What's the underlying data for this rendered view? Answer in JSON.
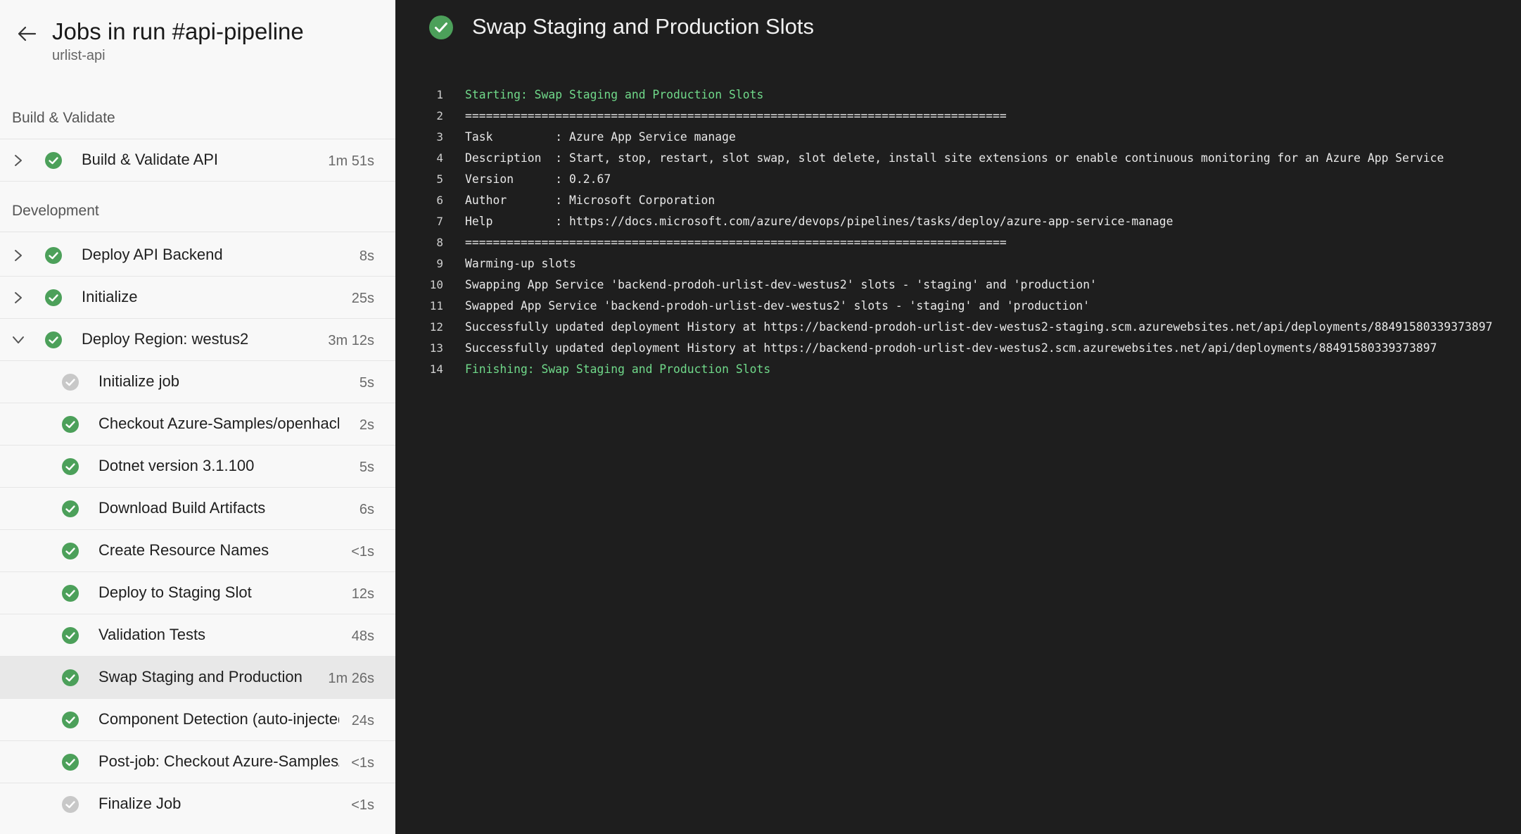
{
  "left_panel": {
    "title": "Jobs in run #api-pipeline",
    "subtitle": "urlist-api",
    "sections": [
      {
        "label": "Build & Validate"
      },
      {
        "label": "Development"
      }
    ],
    "jobs": [
      {
        "label": "Build & Validate API",
        "duration": "1m 51s",
        "expanded": false,
        "status": "succeeded"
      },
      {
        "label": "Deploy API Backend",
        "duration": "8s",
        "expanded": false,
        "status": "succeeded"
      },
      {
        "label": "Initialize",
        "duration": "25s",
        "expanded": false,
        "status": "succeeded"
      },
      {
        "label": "Deploy Region: westus2",
        "duration": "3m 12s",
        "expanded": true,
        "status": "succeeded"
      }
    ],
    "steps": [
      {
        "label": "Initialize job",
        "duration": "5s",
        "status": "skipped"
      },
      {
        "label": "Checkout Azure-Samples/openhack-devops-team@master to s",
        "duration": "2s",
        "status": "succeeded"
      },
      {
        "label": "Dotnet version 3.1.100",
        "duration": "5s",
        "status": "succeeded"
      },
      {
        "label": "Download Build Artifacts",
        "duration": "6s",
        "status": "succeeded"
      },
      {
        "label": "Create Resource Names",
        "duration": "<1s",
        "status": "succeeded"
      },
      {
        "label": "Deploy to Staging Slot",
        "duration": "12s",
        "status": "succeeded"
      },
      {
        "label": "Validation Tests",
        "duration": "48s",
        "status": "succeeded"
      },
      {
        "label": "Swap Staging and Production Slots",
        "duration": "1m 26s",
        "status": "succeeded",
        "selected": true
      },
      {
        "label": "Component Detection (auto-injected by policy)",
        "duration": "24s",
        "status": "succeeded"
      },
      {
        "label": "Post-job: Checkout Azure-Samples/openhack-devops-team@master",
        "duration": "<1s",
        "status": "succeeded"
      },
      {
        "label": "Finalize Job",
        "duration": "<1s",
        "status": "skipped"
      }
    ]
  },
  "log_panel": {
    "title": "Swap Staging and Production Slots",
    "status": "succeeded",
    "lines": [
      {
        "n": "1",
        "text": "Starting: Swap Staging and Production Slots",
        "highlight": true
      },
      {
        "n": "2",
        "text": "==============================================================================",
        "highlight": false
      },
      {
        "n": "3",
        "text": "Task         : Azure App Service manage",
        "highlight": false
      },
      {
        "n": "4",
        "text": "Description  : Start, stop, restart, slot swap, slot delete, install site extensions or enable continuous monitoring for an Azure App Service",
        "highlight": false
      },
      {
        "n": "5",
        "text": "Version      : 0.2.67",
        "highlight": false
      },
      {
        "n": "6",
        "text": "Author       : Microsoft Corporation",
        "highlight": false
      },
      {
        "n": "7",
        "text": "Help         : https://docs.microsoft.com/azure/devops/pipelines/tasks/deploy/azure-app-service-manage",
        "highlight": false
      },
      {
        "n": "8",
        "text": "==============================================================================",
        "highlight": false
      },
      {
        "n": "9",
        "text": "Warming-up slots",
        "highlight": false
      },
      {
        "n": "10",
        "text": "Swapping App Service 'backend-prodoh-urlist-dev-westus2' slots - 'staging' and 'production'",
        "highlight": false
      },
      {
        "n": "11",
        "text": "Swapped App Service 'backend-prodoh-urlist-dev-westus2' slots - 'staging' and 'production'",
        "highlight": false
      },
      {
        "n": "12",
        "text": "Successfully updated deployment History at https://backend-prodoh-urlist-dev-westus2-staging.scm.azurewebsites.net/api/deployments/88491580339373897",
        "highlight": false
      },
      {
        "n": "13",
        "text": "Successfully updated deployment History at https://backend-prodoh-urlist-dev-westus2.scm.azurewebsites.net/api/deployments/88491580339373897",
        "highlight": false
      },
      {
        "n": "14",
        "text": "Finishing: Swap Staging and Production Slots",
        "highlight": true
      }
    ]
  },
  "colors": {
    "success": "#4ca05a",
    "skipped": "#c8c8c8",
    "log_highlight": "#70d98a",
    "log_background": "#1e1e1e"
  },
  "icons": {
    "back": "arrow-left-icon",
    "collapsed": "chevron-right-icon",
    "expanded": "chevron-down-icon",
    "succeeded": "check-circle-icon",
    "skipped": "skipped-circle-icon"
  }
}
